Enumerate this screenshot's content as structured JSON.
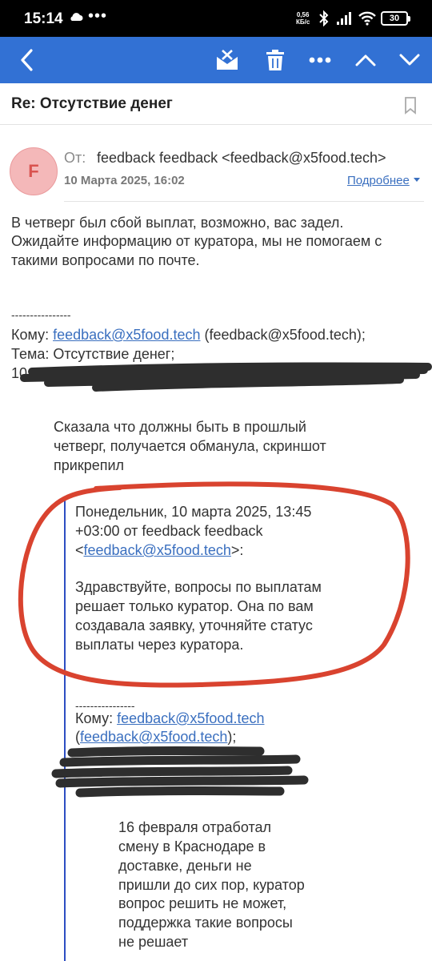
{
  "status_bar": {
    "time": "15:14",
    "dots": "•••",
    "net_speed_value": "0,56",
    "net_speed_unit": "КБ/с",
    "battery": "30"
  },
  "toolbar": {
    "icons": [
      "back-arrow-icon",
      "mark-unread-icon",
      "trash-icon",
      "more-icon",
      "chevron-up-icon",
      "chevron-down-icon"
    ],
    "accent_color": "#3271d4"
  },
  "message": {
    "subject": "Re: Отсутствие денег",
    "avatar_letter": "F",
    "from_label": "От:",
    "from_value": "feedback feedback <feedback@x5food.tech>",
    "date": "10 Марта 2025, 16:02",
    "details_link": "Подробнее"
  },
  "body": {
    "reply_lines": [
      "В четверг был сбой выплат, возможно, вас задел.",
      "Ожидайте информацию от куратора, мы не помогаем с",
      "такими вопросами по почте."
    ],
    "separator": "----------------",
    "to_label": "Кому: ",
    "to_email": "feedback@x5food.tech",
    "to_suffix": " (feedback@x5food.tech);",
    "subject_line": "Тема: Отсутствие денег;",
    "date_line": "10.03.2025, 14:29, \"Полина\"",
    "quoted_user_lines": [
      "Сказала что должны быть в прошлый",
      "четверг, получается обманула, скриншот",
      "прикрепил"
    ],
    "nested_header_line1": "Понедельник, 10 марта 2025, 13:45",
    "nested_header_line2": "+03:00 от feedback feedback",
    "nested_header_open": "<",
    "nested_header_email": "feedback@x5food.tech",
    "nested_header_close": ">:",
    "nested_reply_lines": [
      "Здравствуйте, вопросы по выплатам",
      "решает только куратор. Она по вам",
      "создавала заявку, уточняйте статус",
      "выплаты через куратора."
    ],
    "nested_separator": "----------------",
    "nested_to_label": "Кому: ",
    "nested_to_email": "feedback@x5food.tech",
    "nested_to_open": "(",
    "nested_to_email2": "feedback@x5food.tech",
    "nested_to_close": ");",
    "original_message_lines": [
      "16 февраля отработал",
      "смену в Краснодаре в",
      "доставке, деньги не",
      "пришли до сих пор, куратор",
      "вопрос решить не может,",
      "поддержка такие вопросы",
      "не решает"
    ]
  }
}
